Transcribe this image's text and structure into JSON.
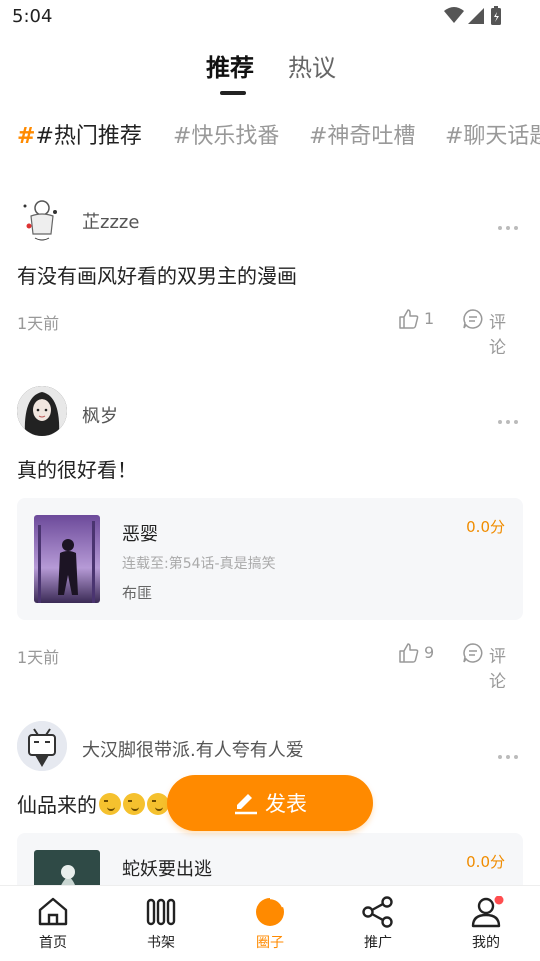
{
  "status_bar": {
    "time": "5:04"
  },
  "top_tabs": [
    {
      "label": "推荐",
      "active": true
    },
    {
      "label": "热议",
      "active": false
    }
  ],
  "topics": [
    {
      "label": "#热门推荐",
      "active": true
    },
    {
      "label": "#快乐找番",
      "active": false
    },
    {
      "label": "#神奇吐槽",
      "active": false
    },
    {
      "label": "#聊天话题",
      "active": false
    }
  ],
  "posts": [
    {
      "author": "芷zzze",
      "text": "有没有画风好看的双男主的漫画",
      "time": "1天前",
      "likes": "1",
      "comment_label": "评论"
    },
    {
      "author": "枫岁",
      "text": "真的很好看！",
      "time": "1天前",
      "likes": "9",
      "comment_label": "评论",
      "book": {
        "title": "恶婴",
        "progress": "连载至:第54话-真是搞笑",
        "author": "布匪",
        "score": "0.0分"
      }
    },
    {
      "author": "大汉脚很带派.有人夸有人爱",
      "text": "仙品来的",
      "emoji_count": 3,
      "book": {
        "title": "蛇妖要出逃",
        "score": "0.0分"
      }
    }
  ],
  "publish_button": {
    "label": "发表",
    "color": "#ff8a00"
  },
  "bottom_nav": [
    {
      "label": "首页",
      "icon": "home-icon",
      "active": false
    },
    {
      "label": "书架",
      "icon": "bookshelf-icon",
      "active": false
    },
    {
      "label": "圈子",
      "icon": "circle-icon",
      "active": true
    },
    {
      "label": "推广",
      "icon": "share-icon",
      "active": false
    },
    {
      "label": "我的",
      "icon": "profile-icon",
      "active": false,
      "badge": true
    }
  ],
  "colors": {
    "accent": "#ff8a00",
    "score": "#f08c00",
    "card_bg": "#f6f7f9"
  }
}
